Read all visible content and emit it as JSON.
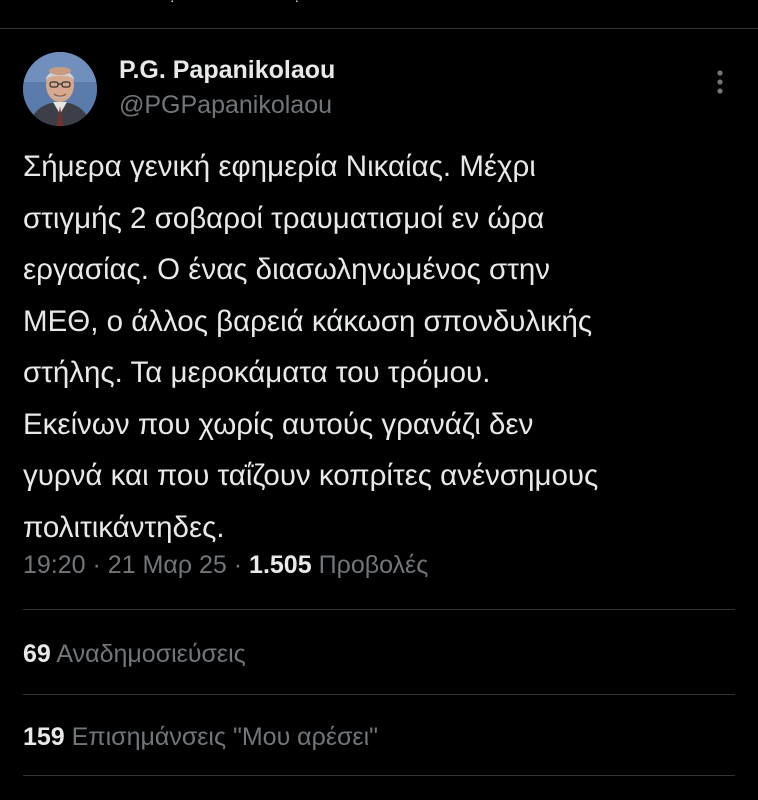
{
  "tweet": {
    "author_name": "P.G. Papanikolaou",
    "author_handle": "@PGPapanikolaou",
    "avatar_icon": "person-portrait-avatar",
    "more_icon": "more-vertical-icon",
    "text": "Σήμερα γενική εφημερία Νικαίας. Μέχρι\nστιγμής 2 σοβαροί τραυματισμοί εν ώρα\nεργασίας. Ο ένας διασωληνωμένος στην\nΜΕΘ, ο άλλος βαρειά κάκωση σπονδυλικής\nστήλης. Τα μεροκάματα του τρόμου.\nΕκείνων που χωρίς αυτούς γρανάζι δεν\nγυρνά και που ταΐζουν κοπρίτες ανένσημους\nπολιτικάντηδες.",
    "time": "19:20",
    "date": "21 Μαρ 25",
    "separator": "·",
    "views_count": "1.505",
    "views_label": "Προβολές"
  },
  "stats": {
    "reposts_count": "69",
    "reposts_label": "Αναδημοσιεύσεις",
    "likes_count": "159",
    "likes_label": "Επισημάνσεις \"Μου αρέσει\""
  },
  "colors": {
    "background": "#000000",
    "primary_text": "#e7e9ea",
    "secondary_text": "#71767b",
    "divider": "#2f3336"
  }
}
